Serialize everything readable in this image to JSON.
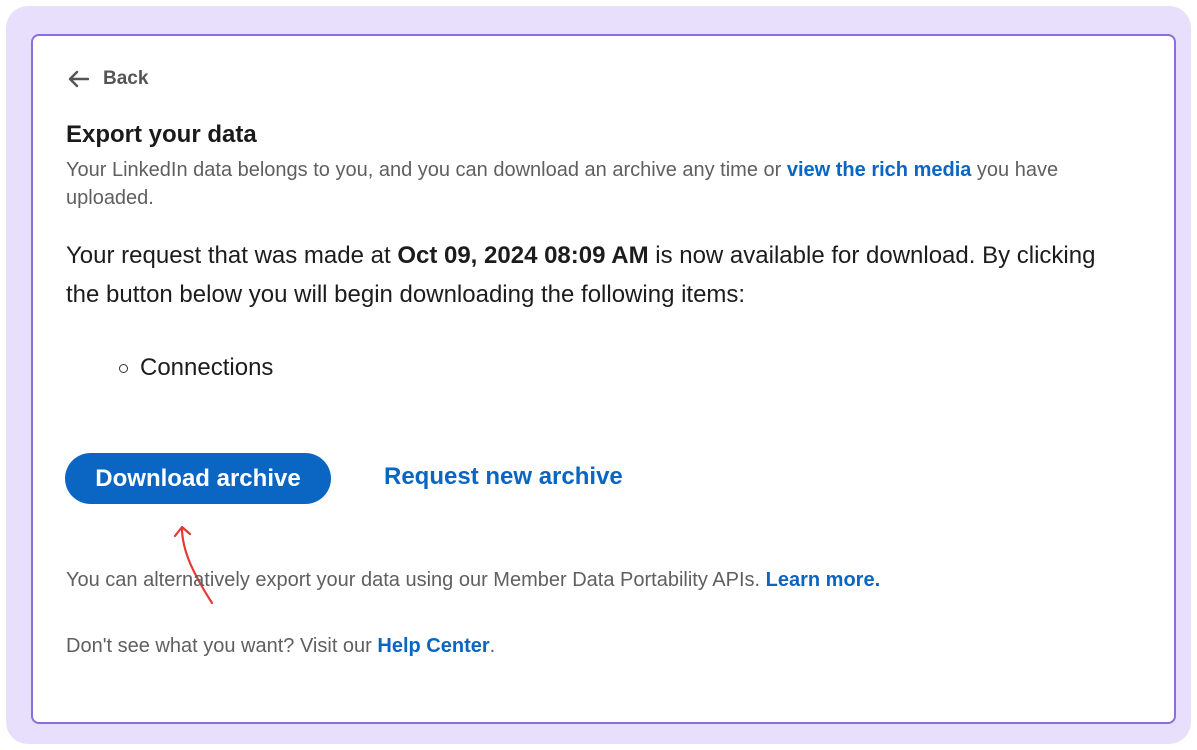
{
  "header": {
    "back_label": "Back"
  },
  "title": "Export your data",
  "description": {
    "text_before": "Your LinkedIn data belongs to you, and you can download an archive any time or ",
    "link": "view the rich media",
    "text_after": " you have uploaded."
  },
  "request": {
    "prefix": "Your request that was made at ",
    "datetime": "Oct 09, 2024 08:09 AM",
    "suffix": " is now available for download. By clicking the button below you will begin downloading the following items:"
  },
  "items": [
    "Connections"
  ],
  "buttons": {
    "download_label": "Download archive",
    "request_new_label": "Request new archive"
  },
  "alternative": {
    "text": "You can alternatively export your data using our Member Data Portability APIs. ",
    "link": "Learn more."
  },
  "help": {
    "text": "Don't see what you want? Visit our ",
    "link": "Help Center",
    "suffix": "."
  },
  "colors": {
    "accent": "#0a66c2",
    "frame": "#e7dffc",
    "card_border": "#8a6fd8",
    "annotation": "#e53935"
  },
  "icons": {
    "back": "arrow-left-icon",
    "bullet": "hollow-circle-bullet",
    "annotation": "hand-drawn-arrow-icon"
  }
}
